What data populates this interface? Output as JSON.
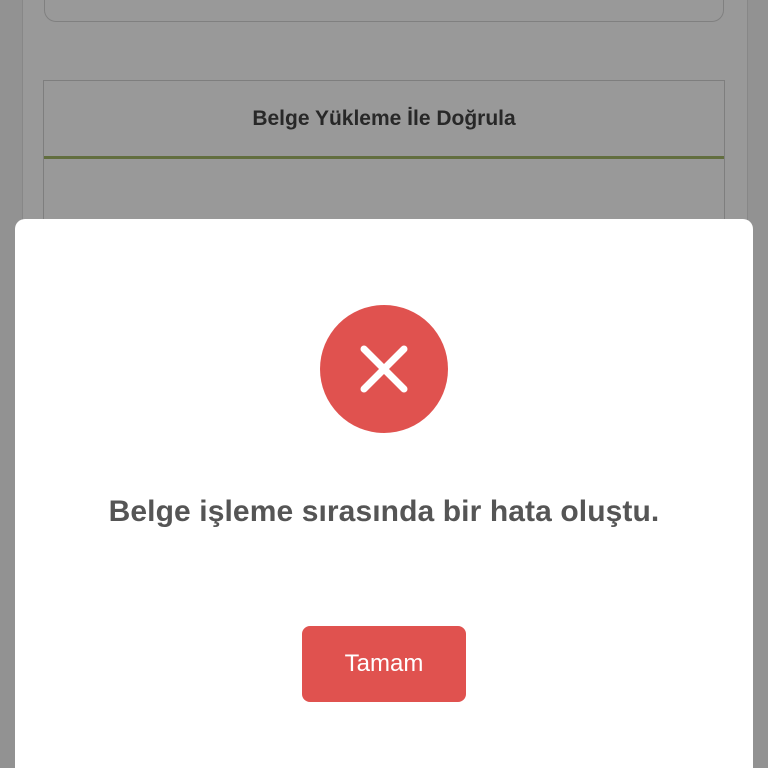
{
  "background": {
    "tab_title": "Belge Yükleme İle Doğrula"
  },
  "modal": {
    "icon": "close-icon",
    "message": "Belge işleme sırasında bir hata oluştu.",
    "ok_label": "Tamam"
  },
  "colors": {
    "error_red": "#e0524f",
    "tab_underline": "#a4b86a",
    "message_text": "#555555"
  }
}
